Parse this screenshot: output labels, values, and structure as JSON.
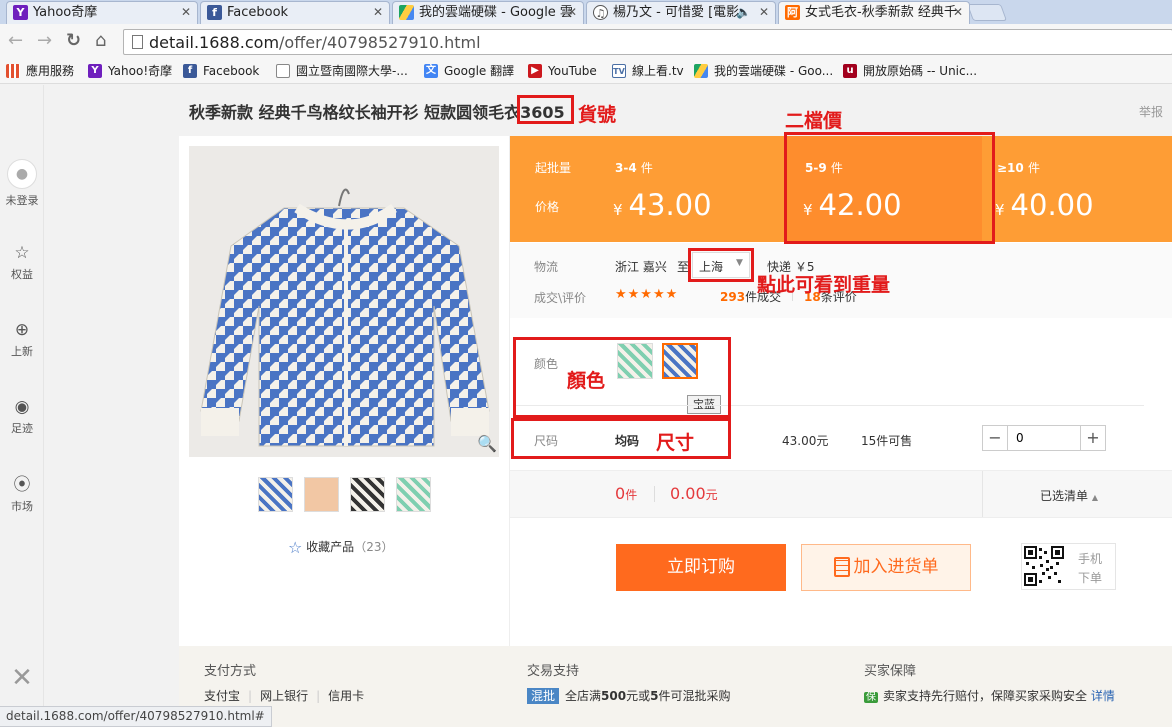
{
  "browser": {
    "tabs": [
      {
        "label": "Yahoo奇摩",
        "icon": "yahoo-icon",
        "active": false
      },
      {
        "label": "Facebook",
        "icon": "facebook-icon",
        "active": false
      },
      {
        "label": "我的雲端硬碟 - Google 雲",
        "icon": "google-drive-icon",
        "active": false
      },
      {
        "label": "楊乃文 - 可惜愛 [電影",
        "icon": "music-icon",
        "active": false
      },
      {
        "label": "女式毛衣-秋季新款 经典千",
        "icon": "alibaba-icon",
        "active": true
      }
    ],
    "url_host": "detail.1688.com",
    "url_path": "/offer/40798527910.html",
    "bookmarks": [
      {
        "label": "應用服務",
        "icon": "apps-grid-icon"
      },
      {
        "label": "Yahoo!奇摩",
        "icon": "yahoo-icon"
      },
      {
        "label": "Facebook",
        "icon": "facebook-icon"
      },
      {
        "label": "國立暨南國際大學-...",
        "icon": "page-icon"
      },
      {
        "label": "Google 翻譯",
        "icon": "google-translate-icon"
      },
      {
        "label": "YouTube",
        "icon": "youtube-icon"
      },
      {
        "label": "線上看.tv",
        "icon": "tv-icon"
      },
      {
        "label": "我的雲端硬碟 - Goo...",
        "icon": "google-drive-icon"
      },
      {
        "label": "開放原始碼 -- Unic...",
        "icon": "unicode-icon"
      }
    ],
    "status_url": "detail.1688.com/offer/40798527910.html#"
  },
  "sidebar": {
    "items": [
      {
        "label": "未登录",
        "icon": "avatar-icon"
      },
      {
        "label": "权益",
        "icon": "star-outline-icon"
      },
      {
        "label": "上新",
        "icon": "plus-circle-icon"
      },
      {
        "label": "足迹",
        "icon": "eye-icon"
      },
      {
        "label": "市场",
        "icon": "location-pin-icon"
      }
    ]
  },
  "product": {
    "title": "秋季新款 经典千鸟格纹长袖开衫 短款圆领毛衣",
    "item_no": "3605",
    "report": "举报",
    "favorite_label": "收藏产品",
    "favorite_count": "（23）"
  },
  "price": {
    "qty_label": "起批量",
    "price_label": "价格",
    "currency": "¥",
    "tiers": [
      {
        "qty": "3-4",
        "unit": "件",
        "price": "43.00"
      },
      {
        "qty": "5-9",
        "unit": "件",
        "price": "42.00"
      },
      {
        "qty": "≥10",
        "unit": "件",
        "price": "40.00"
      }
    ]
  },
  "logistics": {
    "label": "物流",
    "from": "浙江 嘉兴",
    "to_prefix": "至",
    "to": "上海",
    "express": "快递 ￥5",
    "deals_label": "成交\\评价",
    "stars": "★★★★★",
    "deals_count": "293",
    "deals_unit": "件成交",
    "review_count": "18",
    "review_unit": "条评价"
  },
  "options": {
    "color_label": "颜色",
    "color_tooltip": "宝蓝",
    "size_label": "尺码",
    "size_value": "均码",
    "size_price": "43.00元",
    "stock": "15件可售",
    "qty_value": "0",
    "minus": "−",
    "plus": "+"
  },
  "summary": {
    "count": "0",
    "count_unit": "件",
    "total": "0.00",
    "total_unit": "元",
    "list_label": "已选清单"
  },
  "actions": {
    "buy_now": "立即订购",
    "add_cart": "加入进货单",
    "mobile_line1": "手机",
    "mobile_line2": "下单"
  },
  "annotations": {
    "item_no": "貨號",
    "second_tier": "二檔價",
    "weight": "點此可看到重量",
    "color": "顏色",
    "size": "尺寸"
  },
  "footer": {
    "payment_title": "支付方式",
    "payment_items": [
      "支付宝",
      "网上银行",
      "信用卡"
    ],
    "trade_title": "交易支持",
    "trade_badge": "混批",
    "trade_text_pre": "全店满",
    "trade_num1": "500",
    "trade_text_mid": "元或",
    "trade_num2": "5",
    "trade_text_post": "件可混批采购",
    "buyer_title": "买家保障",
    "buyer_badge": "保",
    "buyer_text": "卖家支持先行赔付，保障买家采购安全",
    "buyer_link": "详情"
  },
  "colors": {
    "accent": "#ff6a1e",
    "price_band": "#fe9d35",
    "price_band_highlight": "#fe8d2d",
    "annotation_red": "#e21b1b",
    "sweater_blue": "#4a74c4"
  }
}
